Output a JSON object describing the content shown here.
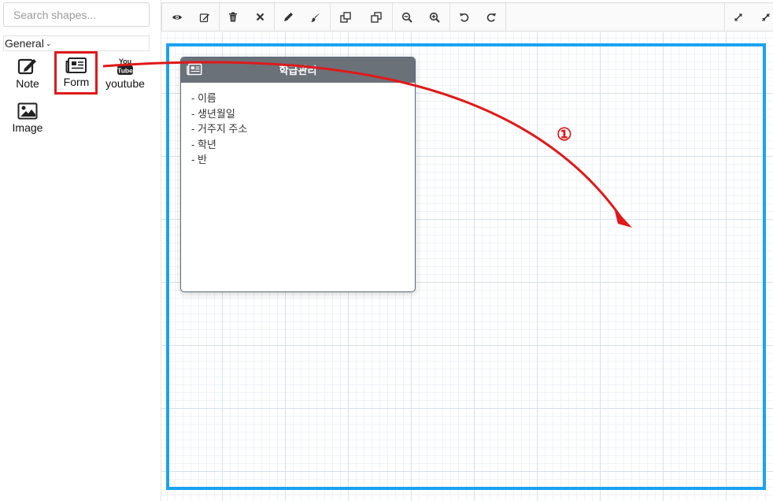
{
  "sidebar": {
    "search_placeholder": "Search shapes...",
    "group_label": "General",
    "shapes": [
      {
        "label": "Note",
        "icon": "edit-icon"
      },
      {
        "label": "Form",
        "icon": "newspaper-icon"
      },
      {
        "label": "youtube",
        "icon": "youtube-icon"
      },
      {
        "label": "Image",
        "icon": "image-icon"
      }
    ]
  },
  "toolbar": {
    "buttons": [
      "eye-icon",
      "edit-icon",
      "trash-icon",
      "close-icon",
      "pencil-icon",
      "brush-icon",
      "bring-front-icon",
      "send-back-icon",
      "zoom-out-icon",
      "zoom-in-icon",
      "undo-icon",
      "redo-icon",
      "expand-icon",
      "collapse-icon"
    ]
  },
  "canvas": {
    "form_card": {
      "title": "학급관리",
      "items": [
        "- 이름",
        "- 생년월일",
        "- 거주지 주소",
        "- 학년",
        "- 반"
      ]
    },
    "annotation": "①",
    "colors": {
      "highlight": "#e0191a",
      "frame": "#1aa3f0",
      "card_header": "#6b7179"
    }
  }
}
